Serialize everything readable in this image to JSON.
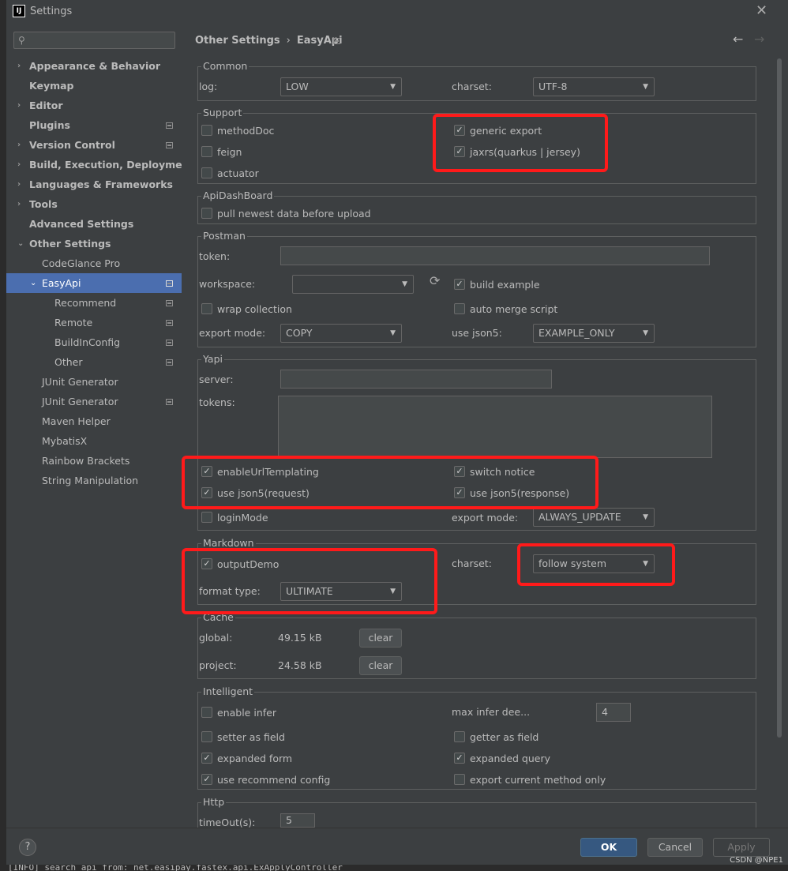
{
  "window": {
    "title": "Settings",
    "app_icon": "IJ"
  },
  "sidebar": {
    "search_placeholder": "",
    "items": [
      {
        "label": "Appearance & Behavior"
      },
      {
        "label": "Keymap"
      },
      {
        "label": "Editor"
      },
      {
        "label": "Plugins"
      },
      {
        "label": "Version Control"
      },
      {
        "label": "Build, Execution, Deployment"
      },
      {
        "label": "Languages & Frameworks"
      },
      {
        "label": "Tools"
      },
      {
        "label": "Advanced Settings"
      },
      {
        "label": "Other Settings"
      },
      {
        "label": "CodeGlance Pro"
      },
      {
        "label": "EasyApi"
      },
      {
        "label": "Recommend"
      },
      {
        "label": "Remote"
      },
      {
        "label": "BuildInConfig"
      },
      {
        "label": "Other"
      },
      {
        "label": "JUnit Generator"
      },
      {
        "label": "JUnit Generator"
      },
      {
        "label": "Maven Helper"
      },
      {
        "label": "MybatisX"
      },
      {
        "label": "Rainbow Brackets"
      },
      {
        "label": "String Manipulation"
      }
    ]
  },
  "breadcrumb": {
    "parent": "Other Settings",
    "separator": "›",
    "current": "EasyApi"
  },
  "common": {
    "title": "Common",
    "log_label": "log:",
    "log_value": "LOW",
    "charset_label": "charset:",
    "charset_value": "UTF-8"
  },
  "support": {
    "title": "Support",
    "method_doc": "methodDoc",
    "method_doc_checked": false,
    "feign": "feign",
    "feign_checked": false,
    "actuator": "actuator",
    "actuator_checked": false,
    "generic_export": "generic export",
    "generic_export_checked": true,
    "jaxrs": "jaxrs(quarkus | jersey)",
    "jaxrs_checked": true
  },
  "apidashboard": {
    "title": "ApiDashBoard",
    "pull_newest": "pull newest data before upload",
    "pull_newest_checked": false
  },
  "postman": {
    "title": "Postman",
    "token_label": "token:",
    "token_value": "",
    "workspace_label": "workspace:",
    "workspace_value": "",
    "build_example": "build example",
    "build_example_checked": true,
    "wrap_collection": "wrap collection",
    "wrap_collection_checked": false,
    "auto_merge_script": "auto merge script",
    "auto_merge_script_checked": false,
    "export_mode_label": "export mode:",
    "export_mode_value": "COPY",
    "use_json5_label": "use json5:",
    "use_json5_value": "EXAMPLE_ONLY"
  },
  "yapi": {
    "title": "Yapi",
    "server_label": "server:",
    "server_value": "",
    "tokens_label": "tokens:",
    "tokens_value": "",
    "enable_url_templating": "enableUrlTemplating",
    "enable_url_templating_checked": true,
    "switch_notice": "switch notice",
    "switch_notice_checked": true,
    "use_json5_request": "use json5(request)",
    "use_json5_request_checked": true,
    "use_json5_response": "use json5(response)",
    "use_json5_response_checked": true,
    "login_mode": "loginMode",
    "login_mode_checked": false,
    "export_mode_label": "export mode:",
    "export_mode_value": "ALWAYS_UPDATE"
  },
  "markdown": {
    "title": "Markdown",
    "output_demo": "outputDemo",
    "output_demo_checked": true,
    "charset_label": "charset:",
    "charset_value": "follow system",
    "format_type_label": "format type:",
    "format_type_value": "ULTIMATE"
  },
  "cache": {
    "title": "Cache",
    "global_label": "global:",
    "global_value": "49.15 kB",
    "project_label": "project:",
    "project_value": "24.58 kB",
    "clear_label": "clear"
  },
  "intelligent": {
    "title": "Intelligent",
    "enable_infer": "enable infer",
    "enable_infer_checked": false,
    "max_infer_label": "max infer dee...",
    "max_infer_value": "4",
    "setter_as_field": "setter as field",
    "setter_as_field_checked": false,
    "getter_as_field": "getter as field",
    "getter_as_field_checked": false,
    "expanded_form": "expanded form",
    "expanded_form_checked": true,
    "expanded_query": "expanded query",
    "expanded_query_checked": true,
    "use_recommend_config": "use recommend config",
    "use_recommend_config_checked": true,
    "export_current_method": "export current method only",
    "export_current_method_checked": false
  },
  "http": {
    "title": "Http",
    "timeout_label": "timeOut(s):",
    "timeout_value": "5"
  },
  "footer": {
    "help": "?",
    "ok": "OK",
    "cancel": "Cancel",
    "apply": "Apply",
    "watermark": "CSDN @NPE1"
  },
  "console_text": "[INFO]  search api from: net.easipay.fastex.api.ExApplyController",
  "icons": {
    "check": "✓",
    "dropdown": "▼",
    "refresh": "⟳",
    "back": "←",
    "forward": "→",
    "close": "✕",
    "chevron_right": "›",
    "chevron_down": "⌄"
  },
  "colors": {
    "selection": "#4b6eaf",
    "highlight": "#ff1a1a",
    "ok_button": "#365880"
  }
}
